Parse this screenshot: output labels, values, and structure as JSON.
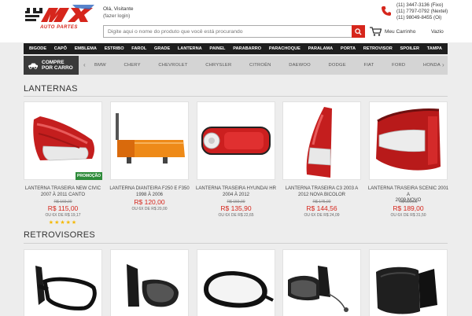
{
  "brand": {
    "logo_text": "AUTO PARTES",
    "logo_mark": "MX",
    "accent": "#d6261c"
  },
  "header": {
    "greeting": "Olá, Visitante",
    "login_link": "(fazer login)",
    "phones": [
      "(11) 3447-3136 (Fixo)",
      "(11) 7797-0792 (Nextel)",
      "(11) 98049-8455 (Oi)"
    ]
  },
  "search": {
    "placeholder": "Digite aqui o nome do produto que você está procurando"
  },
  "cart": {
    "label": "Meu Carrinho",
    "status": "Vazio"
  },
  "categories": [
    "BIGODE",
    "CAPÔ",
    "EMBLEMA",
    "ESTRIBO",
    "FAROL",
    "GRADE",
    "LANTERNA",
    "PAINEL",
    "PARABARRO",
    "PARACHOQUE",
    "PARALAMA",
    "PORTA",
    "RETROVISOR",
    "SPOILER",
    "TAMPA"
  ],
  "brand_bar": {
    "label_line1": "COMPRE",
    "label_line2": "POR CARRO",
    "brands": [
      "BMW",
      "CHERY",
      "CHEVROLET",
      "CHRYSLER",
      "CITROËN",
      "DAEWOO",
      "DODGE",
      "FIAT",
      "FORD",
      "HONDA"
    ]
  },
  "sections": {
    "lanternas": {
      "title": "LANTERNAS",
      "products": [
        {
          "name_line1": "LANTERNA TRASEIRA NEW CIVIC",
          "name_line2": "2007 À 2011 CANTO",
          "old_price": "R$ 169,00",
          "price": "R$ 115,00",
          "installments": "OU 6X DE R$ 19,17",
          "badge": "PROMOÇÃO",
          "rating": "★★★★★"
        },
        {
          "name_line1": "LANTERNA DIANTEIRA F250 E F350",
          "name_line2": "1998 À 2006",
          "old_price": "",
          "price": "R$ 120,00",
          "installments": "OU 6X DE R$ 20,00"
        },
        {
          "name_line1": "LANTERNA TRASEIRA HYUNDAI HR",
          "name_line2": "2004 À 2012",
          "old_price": "R$ 159,00",
          "price": "R$ 135,90",
          "installments": "OU 6X DE R$ 22,65"
        },
        {
          "name_line1": "LANTERNA TRASEIRA C3 2003 A",
          "name_line2": "2012 NOVA BICOLOR",
          "old_price": "R$ 175,00",
          "price": "R$ 144,56",
          "installments": "OU 6X DE R$ 24,09"
        },
        {
          "name_line1": "LANTERNA TRASEIRA SCENIC 2001 A",
          "name_line2": "2009 NOVO",
          "old_price": "R$ 220,00",
          "price": "R$ 189,00",
          "installments": "OU 6X DE R$ 31,50"
        }
      ]
    },
    "retrovisores": {
      "title": "RETROVISORES"
    }
  }
}
